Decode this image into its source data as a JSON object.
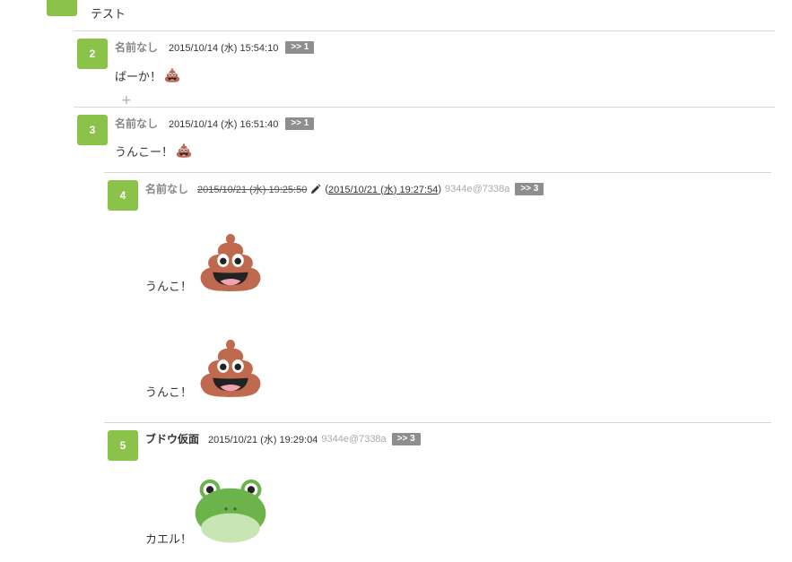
{
  "post1": {
    "text": "テスト"
  },
  "post2": {
    "number": "2",
    "name": "名前なし",
    "date": "2015/10/14 (水) 15:54:10",
    "reply": ">> 1",
    "text": "ばーか！"
  },
  "post3": {
    "number": "3",
    "name": "名前なし",
    "date": "2015/10/14 (水) 16:51:40",
    "reply": ">> 1",
    "text": "うんこー！"
  },
  "post4": {
    "number": "4",
    "name": "名前なし",
    "date_original": "2015/10/21 (水) 19:25:50",
    "open_paren": "(",
    "date_edited": "2015/10/21 (水) 19:27:54",
    "close_paren": ")",
    "id_hash": "9344e@7338a",
    "reply": ">> 3",
    "line1": "うんこ！",
    "line2": "うんこ！"
  },
  "post5": {
    "number": "5",
    "name": "ブドウ仮面",
    "date": "2015/10/21 (水) 19:29:04",
    "id_hash": "9344e@7338a",
    "reply": ">> 3",
    "text": "カエル！"
  },
  "icons": {
    "poop": "pile-of-poo-icon",
    "frog": "frog-face-icon",
    "pencil": "pencil-icon",
    "plus": "plus-icon"
  },
  "colors": {
    "badge": "#8bc34a",
    "reply_tag": "#8e8e8e",
    "poop": "#bf6a4f",
    "frog": "#6db34b"
  }
}
